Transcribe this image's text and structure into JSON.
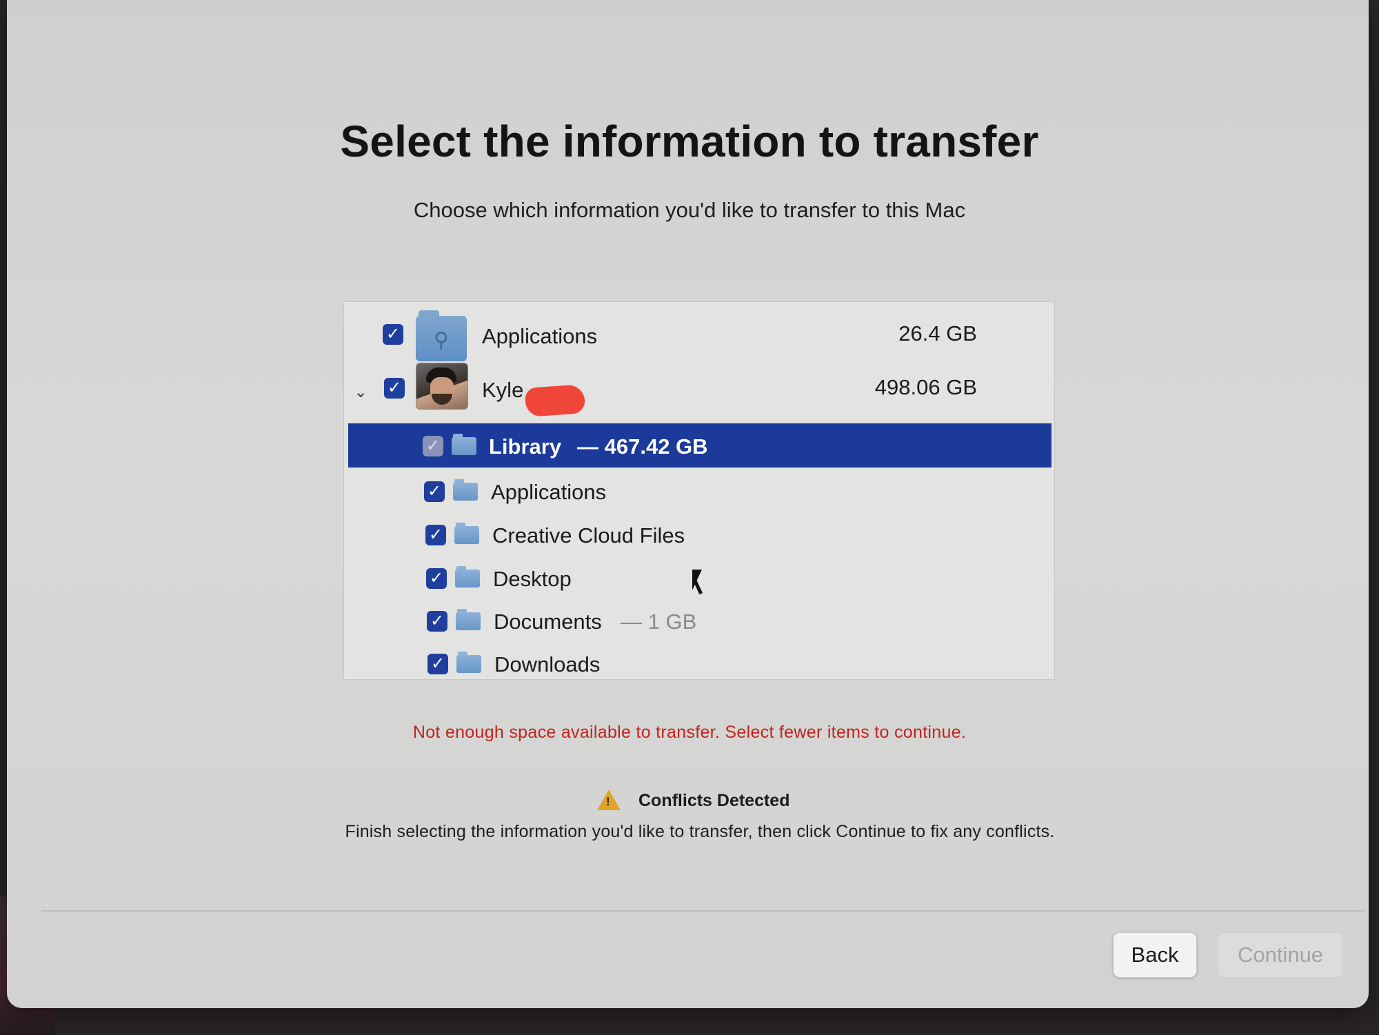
{
  "page": {
    "title": "Select the information to transfer",
    "subtitle": "Choose which information you'd like to transfer to this Mac"
  },
  "list": {
    "items": [
      {
        "label": "Applications",
        "size": "26.4 GB",
        "checked": true,
        "icon": "app-folder-icon"
      },
      {
        "label": "Kyle",
        "size": "498.06 GB",
        "checked": true,
        "expanded": true,
        "icon": "user-avatar"
      }
    ],
    "children": [
      {
        "label": "Library",
        "size": "— 467.42 GB",
        "checked": true,
        "selected": true,
        "icon": "folder-icon"
      },
      {
        "label": "Applications",
        "size": "",
        "checked": true,
        "icon": "folder-icon"
      },
      {
        "label": "Creative Cloud Files",
        "size": "",
        "checked": true,
        "icon": "folder-icon"
      },
      {
        "label": "Desktop",
        "size": "",
        "checked": true,
        "icon": "folder-icon"
      },
      {
        "label": "Documents",
        "size": "— 1 GB",
        "checked": true,
        "icon": "folder-icon"
      },
      {
        "label": "Downloads",
        "size": "",
        "checked": true,
        "icon": "folder-icon"
      }
    ]
  },
  "error": {
    "message": "Not enough space available to transfer. Select fewer items to continue."
  },
  "conflicts": {
    "title": "Conflicts Detected",
    "message": "Finish selecting the information you'd like to transfer, then click Continue to fix any conflicts."
  },
  "buttons": {
    "back": "Back",
    "continue": "Continue"
  },
  "glyphs": {
    "check": "✓",
    "chevron": "⌄",
    "warning": "!"
  },
  "colors": {
    "selection": "#1b3a9a",
    "checkbox": "#1f3f9e",
    "error": "#c0241e",
    "warning": "#e0a42a"
  }
}
